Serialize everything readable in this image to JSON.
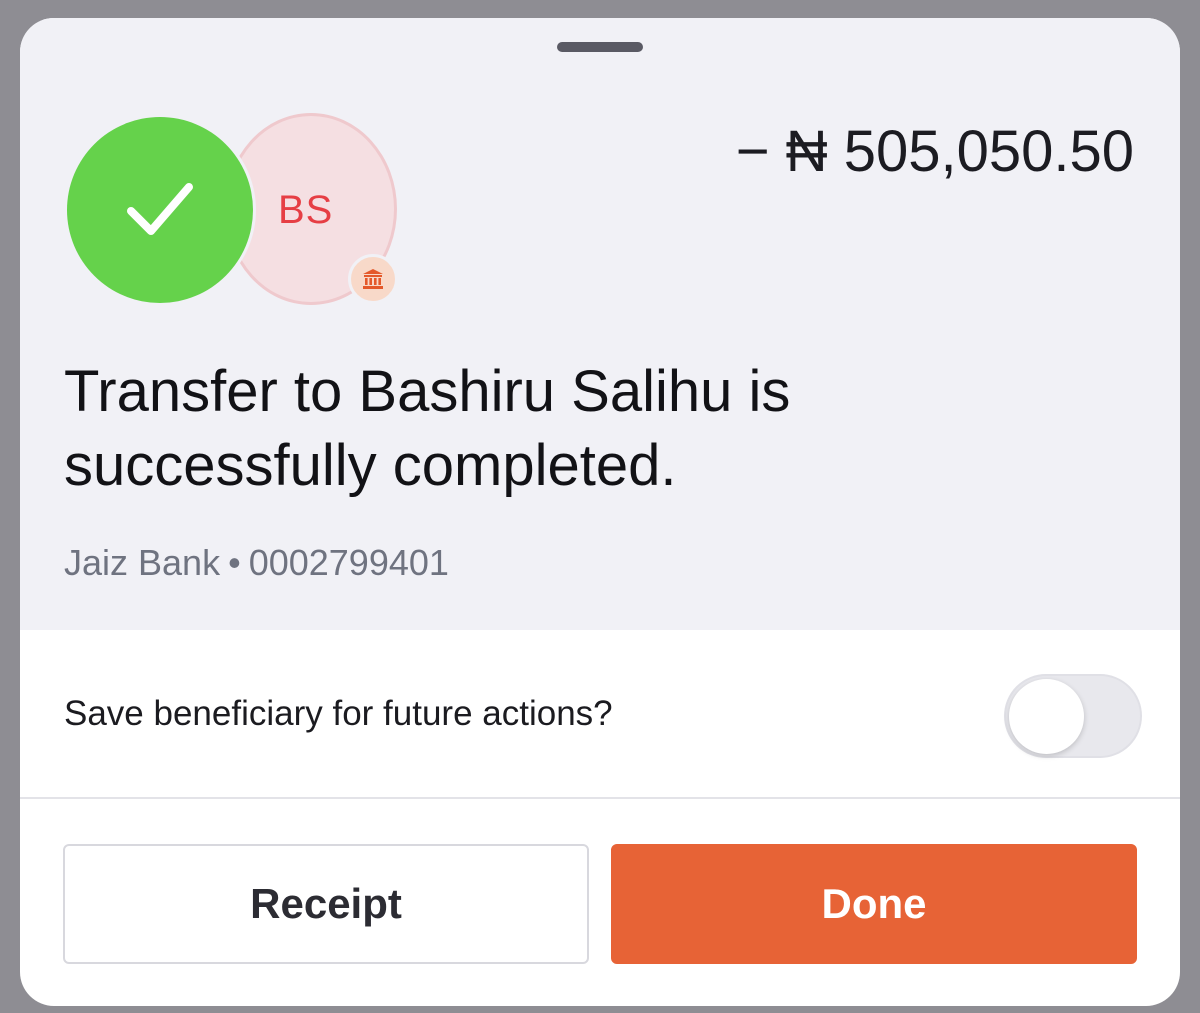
{
  "sheet": {
    "amount": "− ₦ 505,050.50",
    "status_icon": "checkmark-icon",
    "avatar": {
      "initials": "BS",
      "badge_icon": "bank-icon"
    },
    "message": "Transfer to Bashiru Salihu is successfully completed.",
    "recipient": {
      "bank": "Jaiz Bank",
      "separator": "•",
      "account_number": "0002799401"
    },
    "save_beneficiary": {
      "label": "Save beneficiary for future actions?",
      "enabled": false
    },
    "buttons": {
      "receipt": "Receipt",
      "done": "Done"
    }
  },
  "colors": {
    "success": "#65d24b",
    "accent": "#e76336",
    "avatar_bg": "#f5dfe2",
    "avatar_text": "#e63e44"
  }
}
